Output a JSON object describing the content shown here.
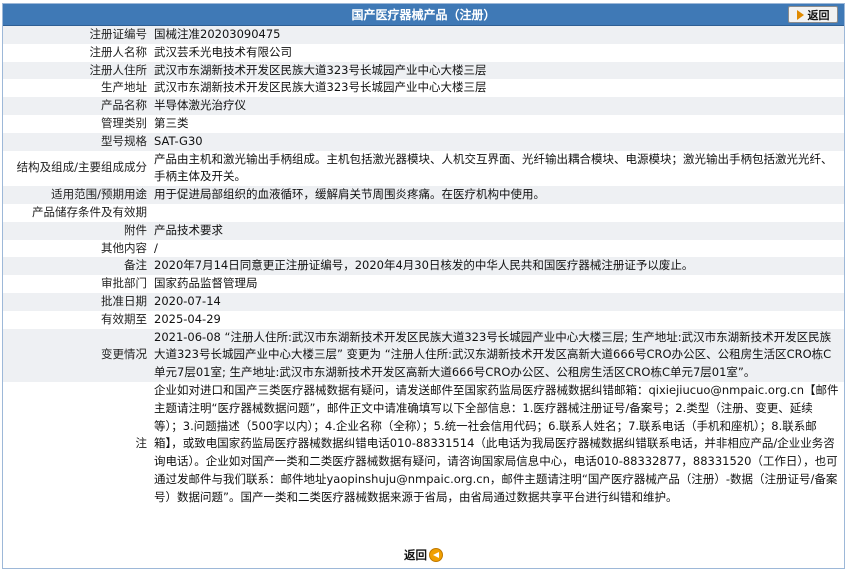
{
  "header": {
    "title": "国产医疗器械产品（注册）",
    "back_label": "返回"
  },
  "rows": [
    {
      "label": "注册证编号",
      "value": "国械注准20203090475"
    },
    {
      "label": "注册人名称",
      "value": "武汉芸禾光电技术有限公司"
    },
    {
      "label": "注册人住所",
      "value": "武汉市东湖新技术开发区民族大道323号长城园产业中心大楼三层"
    },
    {
      "label": "生产地址",
      "value": "武汉市东湖新技术开发区民族大道323号长城园产业中心大楼三层"
    },
    {
      "label": "产品名称",
      "value": "半导体激光治疗仪"
    },
    {
      "label": "管理类别",
      "value": "第三类"
    },
    {
      "label": "型号规格",
      "value": "SAT-G30"
    },
    {
      "label": "结构及组成/主要组成成分",
      "value": "产品由主机和激光输出手柄组成。主机包括激光器模块、人机交互界面、光纤输出耦合模块、电源模块；激光输出手柄包括激光光纤、手柄主体及开关。"
    },
    {
      "label": "适用范围/预期用途",
      "value": "用于促进局部组织的血液循环，缓解肩关节周围炎疼痛。在医疗机构中使用。"
    },
    {
      "label": "产品储存条件及有效期",
      "value": ""
    },
    {
      "label": "附件",
      "value": "产品技术要求"
    },
    {
      "label": "其他内容",
      "value": "/"
    },
    {
      "label": "备注",
      "value": "2020年7月14日同意更正注册证编号，2020年4月30日核发的中华人民共和国医疗器械注册证予以废止。"
    },
    {
      "label": "审批部门",
      "value": "国家药品监督管理局"
    },
    {
      "label": "批准日期",
      "value": "2020-07-14"
    },
    {
      "label": "有效期至",
      "value": "2025-04-29"
    },
    {
      "label": "变更情况",
      "value": "2021-06-08 “注册人住所:武汉市东湖新技术开发区民族大道323号长城园产业中心大楼三层; 生产地址:武汉市东湖新技术开发区民族大道323号长城园产业中心大楼三层” 变更为 “注册人住所:武汉东湖新技术开发区高新大道666号CRO办公区、公租房生活区CRO栋C单元7层01室; 生产地址:武汉市东湖新技术开发区高新大道666号CRO办公区、公租房生活区CRO栋C单元7层01室”。"
    },
    {
      "label": "注",
      "value": "企业如对进口和国产三类医疗器械数据有疑问，请发送邮件至国家药监局医疗器械数据纠错邮箱：qixiejiucuo@nmpaic.org.cn【邮件主题请注明“医疗器械数据问题”，邮件正文中请准确填写以下全部信息：1.医疗器械注册证号/备案号；2.类型（注册、变更、延续等）；3.问题描述（500字以内）；4.企业名称（全称）；5.统一社会信用代码；6.联系人姓名；7.联系电话（手机和座机）；8.联系邮箱】，或致电国家药监局医疗器械数据纠错电话010-88331514（此电话为我局医疗器械数据纠错联系电话，并非相应产品/企业业务咨询电话）。企业如对国产一类和二类医疗器械数据有疑问，请咨询国家局信息中心，电话010-88332877，88331520（工作日），也可通过发邮件与我们联系：邮件地址yaopinshuju@nmpaic.org.cn，邮件主题请注明“国产医疗器械产品（注册）-数据（注册证号/备案号）数据问题”。国产一类和二类医疗器械数据来源于省局，由省局通过数据共享平台进行纠错和维护。"
    }
  ],
  "footer": {
    "back_label": "返回"
  }
}
